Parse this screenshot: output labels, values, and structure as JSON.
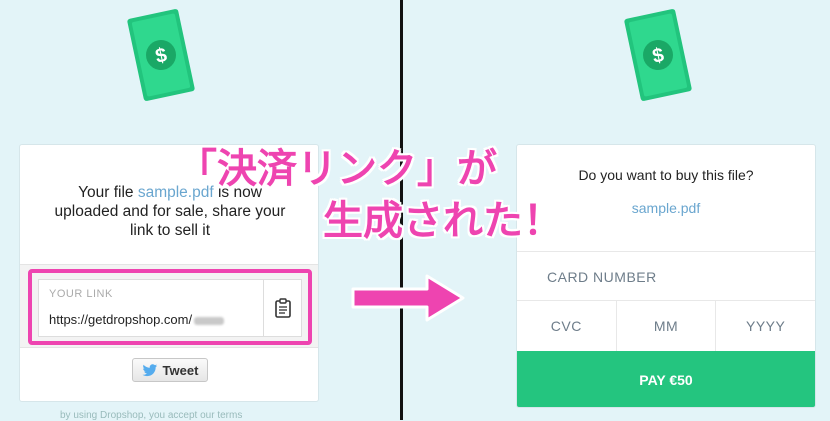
{
  "left_panel": {
    "message_prefix": "Your file ",
    "file_name": "sample.pdf",
    "message_suffix": " is now uploaded and for sale, share your link to sell it",
    "link_label": "YOUR LINK",
    "link_url": "https://getdropshop.com/",
    "tweet_label": "Tweet",
    "footer_text": "by using Dropshop, you accept our terms"
  },
  "right_panel": {
    "question": "Do you want to buy this file?",
    "file_name": "sample.pdf",
    "card_number_label": "CARD NUMBER",
    "cvc_label": "CVC",
    "mm_label": "MM",
    "yyyy_label": "YYYY",
    "pay_label": "PAY €50"
  },
  "annotation": {
    "line1": "「決済リンク」が",
    "line2": "生成された！"
  },
  "colors": {
    "background": "#e3f4f8",
    "accent_pink": "#ee44b0",
    "pay_green": "#24c57f",
    "link_blue": "#6aa6cf"
  },
  "icons": [
    "money-icon",
    "clipboard-icon",
    "twitter-bird-icon",
    "arrow-right-icon"
  ]
}
